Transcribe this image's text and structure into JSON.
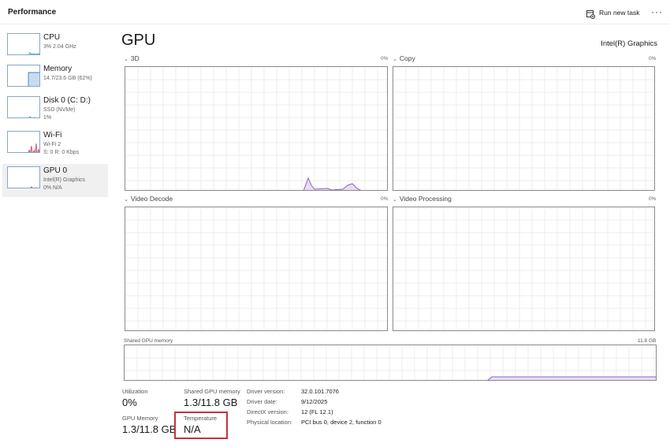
{
  "header": {
    "title": "Performance",
    "run_new_task": "Run new task",
    "more": "···"
  },
  "sidebar": {
    "items": [
      {
        "name": "CPU",
        "line1": "3% 2.04 GHz",
        "line2": "",
        "selected": false
      },
      {
        "name": "Memory",
        "line1": "14.7/23.6 GB (62%)",
        "line2": "",
        "selected": false
      },
      {
        "name": "Disk 0 (C: D:)",
        "line1": "SSD (NVMe)",
        "line2": "1%",
        "selected": false
      },
      {
        "name": "Wi-Fi",
        "line1": "Wi-Fi 2",
        "line2": "S: 0 R: 0 Kbps",
        "selected": false
      },
      {
        "name": "GPU 0",
        "line1": "Intel(R) Graphics",
        "line2": "0% N/A",
        "selected": true
      }
    ]
  },
  "main": {
    "title": "GPU",
    "adapter": "Intel(R) Graphics"
  },
  "graphs": [
    {
      "label": "3D",
      "percent": "0%"
    },
    {
      "label": "Copy",
      "percent": "0%"
    },
    {
      "label": "Video Decode",
      "percent": "0%"
    },
    {
      "label": "Video Processing",
      "percent": "0%"
    }
  ],
  "shared_memory_graph": {
    "label": "Shared GPU memory",
    "max": "11.8 GB"
  },
  "stats": {
    "utilization": {
      "label": "Utilization",
      "value": "0%"
    },
    "shared_gpu_memory": {
      "label": "Shared GPU memory",
      "value": "1.3/11.8 GB"
    },
    "gpu_memory": {
      "label": "GPU Memory",
      "value": "1.3/11.8 GB"
    },
    "temperature": {
      "label": "Temperature",
      "value": "N/A"
    }
  },
  "info": {
    "driver_version": {
      "key": "Driver version:",
      "value": "32.0.101.7076"
    },
    "driver_date": {
      "key": "Driver date:",
      "value": "9/12/2025"
    },
    "directx_version": {
      "key": "DirectX version:",
      "value": "12 (FL 12.1)"
    },
    "physical_location": {
      "key": "Physical location:",
      "value": "PCI bus 0, device 2, function 0"
    }
  },
  "colors": {
    "gpu_fill": "#e9ddf6",
    "gpu_line": "#8a63c9",
    "grid": "#ececec",
    "highlight_box": "#c0343f"
  }
}
